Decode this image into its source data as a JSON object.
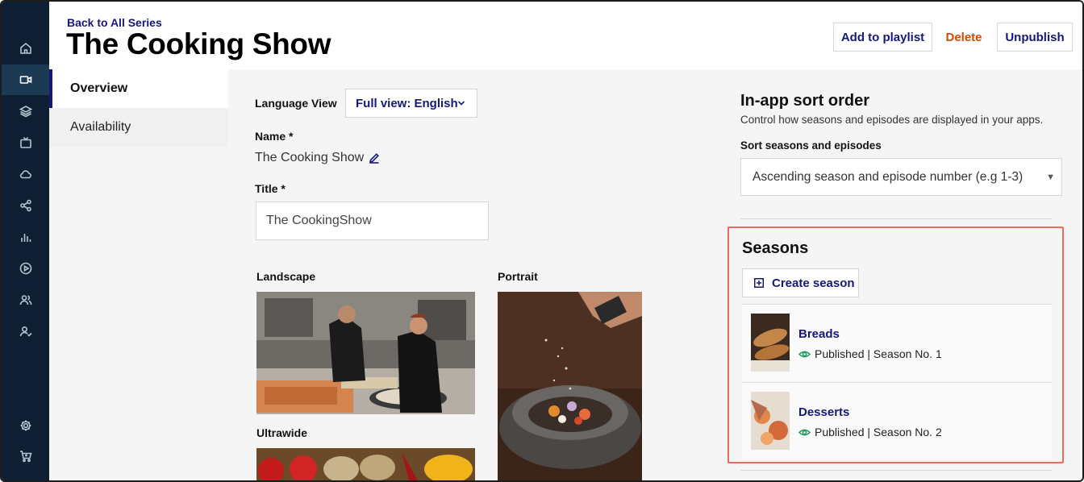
{
  "header": {
    "back_link": "Back to All Series",
    "title": "The Cooking Show",
    "add_to_playlist": "Add to playlist",
    "delete": "Delete",
    "unpublish": "Unpublish"
  },
  "sidebar": {
    "items": [
      {
        "icon": "home-icon"
      },
      {
        "icon": "video-camera-icon",
        "active": true
      },
      {
        "icon": "layers-icon"
      },
      {
        "icon": "tv-icon"
      },
      {
        "icon": "cloud-icon"
      },
      {
        "icon": "share-icon"
      },
      {
        "icon": "bar-chart-icon"
      },
      {
        "icon": "play-circle-icon"
      },
      {
        "icon": "users-icon"
      },
      {
        "icon": "user-check-icon"
      },
      {
        "icon": "gear-icon"
      },
      {
        "icon": "cart-icon"
      }
    ]
  },
  "tabs": [
    {
      "label": "Overview",
      "active": true
    },
    {
      "label": "Availability",
      "active": false
    }
  ],
  "main": {
    "language_label": "Language View",
    "language_value": "Full view: English",
    "name_label": "Name *",
    "name_value": "The Cooking Show",
    "title_label": "Title *",
    "title_value": "The CookingShow",
    "images": {
      "landscape_label": "Landscape",
      "portrait_label": "Portrait",
      "ultrawide_label": "Ultrawide"
    }
  },
  "sort": {
    "title": "In-app sort order",
    "description": "Control how seasons and episodes are displayed in your apps.",
    "select_label": "Sort seasons and episodes",
    "select_value": "Ascending season and episode number (e.g 1-3)"
  },
  "seasons": {
    "title": "Seasons",
    "create_label": "Create season",
    "items": [
      {
        "name": "Breads",
        "meta": "Published | Season No. 1"
      },
      {
        "name": "Desserts",
        "meta": "Published | Season No. 2"
      }
    ]
  },
  "colors": {
    "sidebar": "#0e1f33",
    "link": "#17177a",
    "danger": "#d24a00",
    "highlight": "#ec6a5e",
    "published": "#1e9b5a"
  }
}
